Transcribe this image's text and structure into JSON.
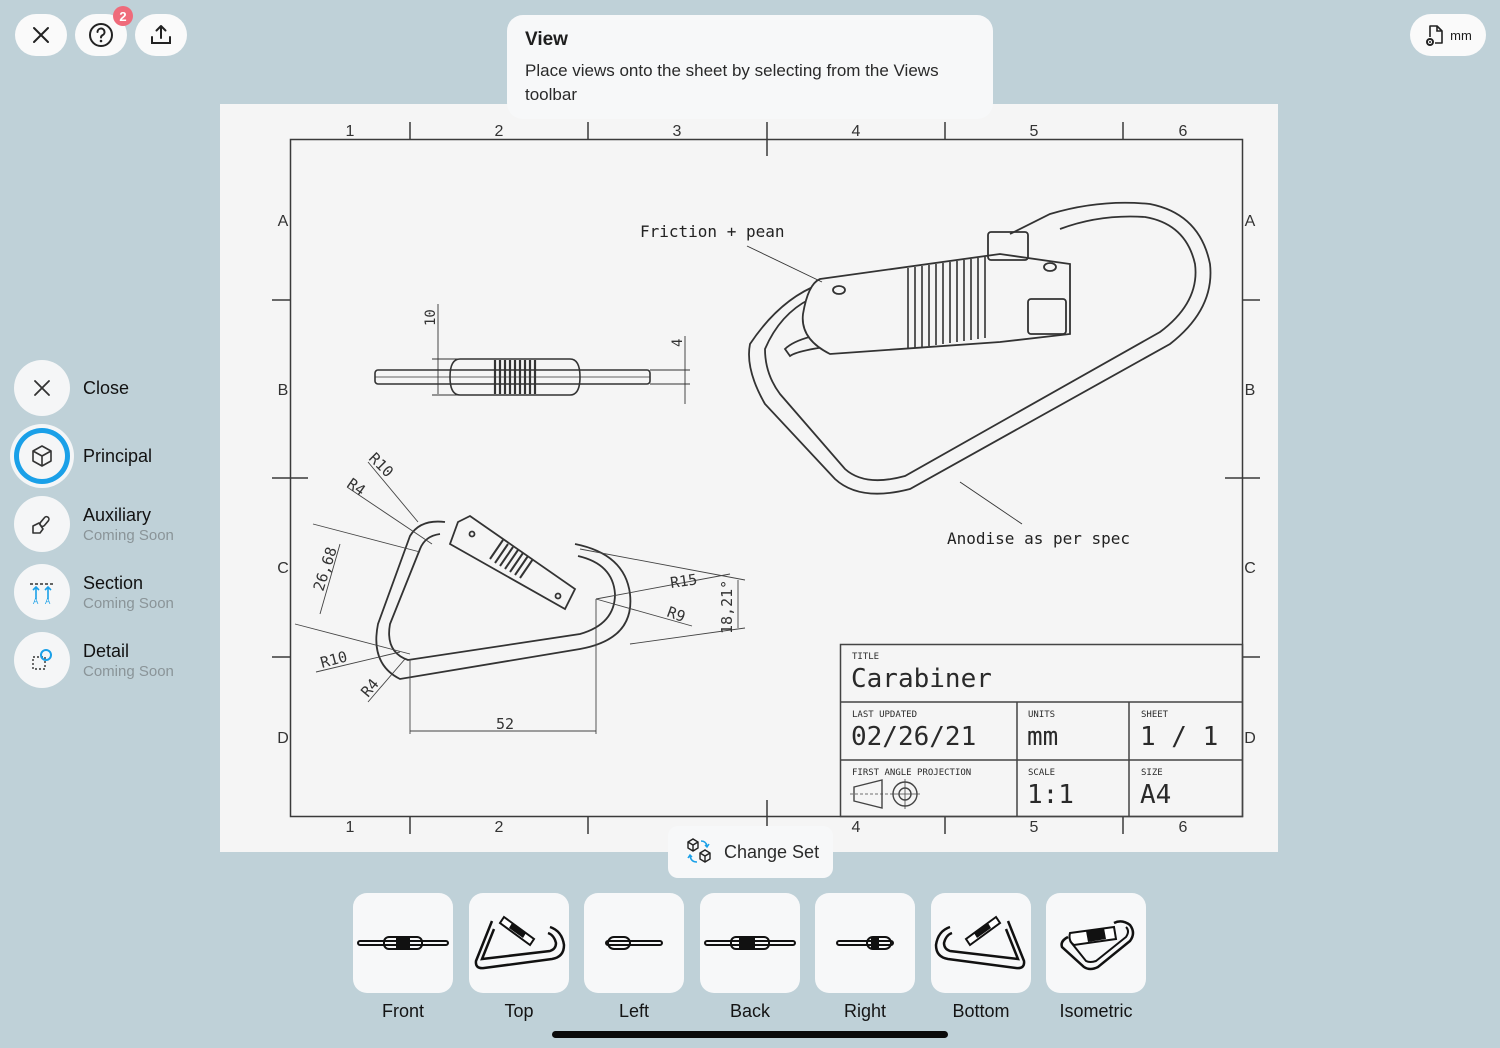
{
  "toolbar": {
    "close_icon": "close-icon",
    "help_icon": "help-icon",
    "help_badge_count": "2",
    "share_icon": "share-icon",
    "units_icon": "document-settings-icon",
    "units_label": "mm"
  },
  "tooltip": {
    "title": "View",
    "body": "Place views onto the sheet by selecting from the Views toolbar"
  },
  "side_menu": {
    "items": [
      {
        "label": "Close",
        "sublabel": "",
        "icon": "close-icon",
        "active": false
      },
      {
        "label": "Principal",
        "sublabel": "",
        "icon": "cube-icon",
        "active": true
      },
      {
        "label": "Auxiliary",
        "sublabel": "Coming Soon",
        "icon": "auxiliary-icon",
        "active": false
      },
      {
        "label": "Section",
        "sublabel": "Coming Soon",
        "icon": "section-icon",
        "active": false
      },
      {
        "label": "Detail",
        "sublabel": "Coming Soon",
        "icon": "detail-icon",
        "active": false
      }
    ]
  },
  "sheet": {
    "column_labels": [
      "1",
      "2",
      "3",
      "4",
      "5",
      "6"
    ],
    "row_labels": [
      "A",
      "B",
      "C",
      "D"
    ],
    "annotations": {
      "friction": "Friction + pean",
      "anodise": "Anodise as per spec"
    },
    "dimensions": {
      "side_height": "10",
      "side_thickness": "4",
      "r10_top": "R10",
      "r4_top": "R4",
      "length_26": "26,68",
      "r10_bottom": "R10",
      "r4_bottom": "R4",
      "r15": "R15",
      "r9": "R9",
      "angle": "18,21°",
      "width_52": "52"
    },
    "title_block": {
      "title_label": "TITLE",
      "title_value": "Carabiner",
      "last_updated_label": "LAST UPDATED",
      "last_updated_value": "02/26/21",
      "units_label": "UNITS",
      "units_value": "mm",
      "sheet_label": "SHEET",
      "sheet_value": "1 / 1",
      "projection_label": "FIRST ANGLE PROJECTION",
      "scale_label": "SCALE",
      "scale_value": "1:1",
      "size_label": "SIZE",
      "size_value": "A4"
    }
  },
  "change_set": {
    "label": "Change Set",
    "icon": "change-set-icon"
  },
  "views": [
    {
      "label": "Front",
      "icon": "front-view-icon"
    },
    {
      "label": "Top",
      "icon": "top-view-icon"
    },
    {
      "label": "Left",
      "icon": "left-view-icon"
    },
    {
      "label": "Back",
      "icon": "back-view-icon"
    },
    {
      "label": "Right",
      "icon": "right-view-icon"
    },
    {
      "label": "Bottom",
      "icon": "bottom-view-icon"
    },
    {
      "label": "Isometric",
      "icon": "isometric-view-icon"
    }
  ],
  "colors": {
    "background": "#bfd1d8",
    "accent": "#1aa0e8",
    "badge": "#ef6b7b",
    "sheet": "#f5f5f5"
  }
}
